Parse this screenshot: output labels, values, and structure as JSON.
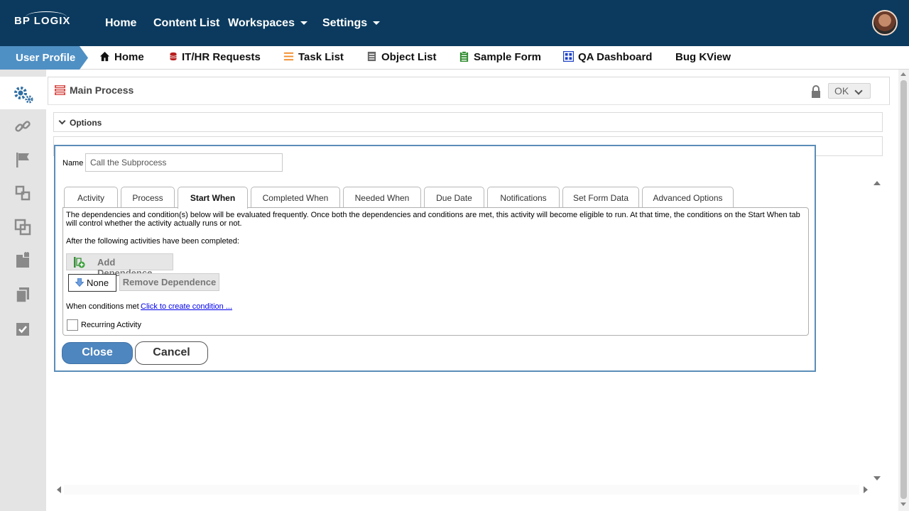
{
  "header": {
    "logo": "BP LOGIX",
    "nav": [
      {
        "label": "Home"
      },
      {
        "label": "Content List"
      },
      {
        "label": "Workspaces"
      },
      {
        "label": "Settings"
      }
    ]
  },
  "favorites": {
    "user_profile": "User Profile",
    "items": [
      {
        "label": "Home",
        "icon": "home-icon"
      },
      {
        "label": "IT/HR Requests",
        "icon": "database-icon"
      },
      {
        "label": "Task List",
        "icon": "list-icon"
      },
      {
        "label": "Object List",
        "icon": "document-icon"
      },
      {
        "label": "Sample Form",
        "icon": "form-icon"
      },
      {
        "label": "QA Dashboard",
        "icon": "dashboard-icon"
      },
      {
        "label": "Bug KView",
        "icon": ""
      }
    ]
  },
  "sidebar": {
    "icons": [
      "gears-icon",
      "link-icon",
      "flag-icon",
      "subprocess-icon",
      "copy-icon",
      "locked-document-icon",
      "documents-icon",
      "checklist-icon"
    ]
  },
  "panel": {
    "title": "Main Process",
    "ok_label": "OK",
    "options_label": "Options"
  },
  "dialog": {
    "name_label": "Name",
    "name_value": "Call the Subprocess",
    "tabs": [
      {
        "label": "Activity"
      },
      {
        "label": "Process"
      },
      {
        "label": "Start When"
      },
      {
        "label": "Completed When"
      },
      {
        "label": "Needed When"
      },
      {
        "label": "Due Date"
      },
      {
        "label": "Notifications"
      },
      {
        "label": "Set Form Data"
      },
      {
        "label": "Advanced Options"
      }
    ],
    "active_tab": "Start When",
    "description": "The dependencies and condition(s) below will be evaluated frequently. Once both the dependencies and conditions are met, this activity will become eligible to run. At that time, the conditions on the Start When tab will control whether the activity actually runs or not.",
    "after_label": "After the following activities have been completed:",
    "add_dependence": "Add Dependence",
    "none_label": "None",
    "remove_dependence": "Remove Dependence",
    "when_conditions_label": "When conditions met",
    "create_condition_link": "Click to create condition ...",
    "recurring_label": "Recurring Activity",
    "recurring_checked": false,
    "close_label": "Close",
    "cancel_label": "Cancel"
  },
  "colors": {
    "topbar": "#0b3a5e",
    "accent": "#4f90c4",
    "dialog_border": "#5b8db8",
    "close_button": "#4e86bf",
    "link": "#0000ee"
  }
}
